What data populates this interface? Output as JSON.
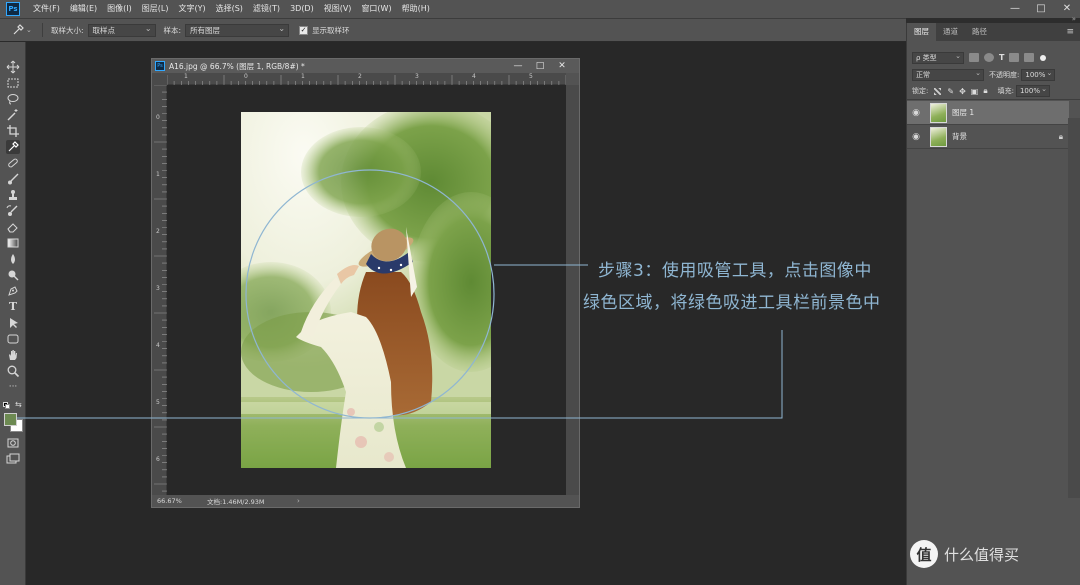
{
  "app": {
    "logo": "Ps"
  },
  "menu": [
    "文件(F)",
    "编辑(E)",
    "图像(I)",
    "图层(L)",
    "文字(Y)",
    "选择(S)",
    "滤镜(T)",
    "3D(D)",
    "视图(V)",
    "窗口(W)",
    "帮助(H)"
  ],
  "window_controls": {
    "minimize": "—",
    "maximize": "□",
    "close": "✕"
  },
  "options": {
    "sample_size_label": "取样大小:",
    "sample_size_value": "取样点",
    "sample_label": "样本:",
    "sample_value": "所有图层",
    "show_ring_label": "显示取样环",
    "show_ring_checked": true
  },
  "document": {
    "title": "A16.jpg @ 66.7% (图层 1, RGB/8#) *",
    "zoom": "66.67%",
    "info": "文档:1.46M/2.93M",
    "status_arrow": "›",
    "controls": {
      "minimize": "—",
      "maximize": "□",
      "close": "✕"
    },
    "ruler_h": [
      "1",
      "0",
      "1",
      "2",
      "3",
      "4",
      "5"
    ],
    "ruler_v": [
      "0",
      "1",
      "2",
      "3",
      "4",
      "5",
      "6"
    ]
  },
  "annotation": {
    "line1": "步骤3：使用吸管工具，点击图像中",
    "line2": "绿色区域，将绿色吸进工具栏前景色中",
    "color": "#8fb6d2"
  },
  "colors": {
    "foreground": "#6d8a52",
    "background": "#ffffff"
  },
  "layers_panel": {
    "tabs": [
      "图层",
      "通道",
      "路径"
    ],
    "active_tab": "图层",
    "filter_label": "ρ 类型",
    "blend_mode": "正常",
    "opacity_label": "不透明度:",
    "opacity_value": "100%",
    "lock_label": "锁定:",
    "fill_label": "填充:",
    "fill_value": "100%",
    "layers": [
      {
        "name": "图层 1",
        "selected": true,
        "locked": false
      },
      {
        "name": "背景",
        "selected": false,
        "locked": true
      }
    ]
  },
  "watermark": {
    "badge": "值",
    "text": "什么值得买"
  }
}
